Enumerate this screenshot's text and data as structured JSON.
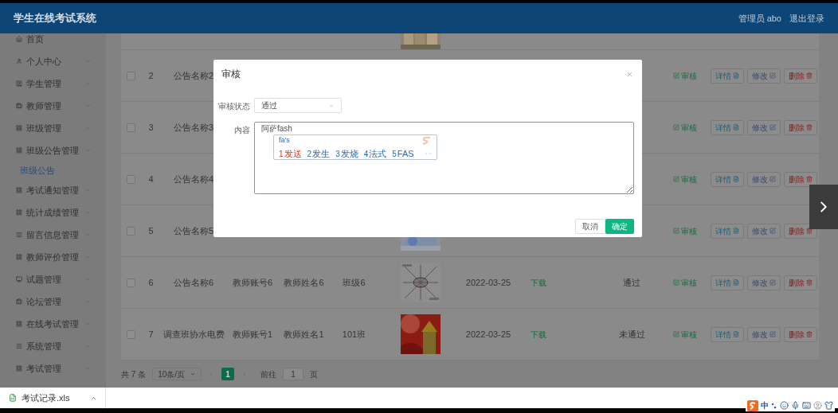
{
  "header": {
    "title": "学生在线考试系统",
    "user": "管理员 abo",
    "logout": "退出登录"
  },
  "sidebar": {
    "items": [
      {
        "label": "首页"
      },
      {
        "label": "个人中心"
      },
      {
        "label": "学生管理"
      },
      {
        "label": "教师管理"
      },
      {
        "label": "班级管理"
      },
      {
        "label": "班级公告管理",
        "children": [
          {
            "label": "班级公告",
            "selected": true
          }
        ]
      },
      {
        "label": "考试通知管理"
      },
      {
        "label": "统计成绩管理"
      },
      {
        "label": "留言信息管理"
      },
      {
        "label": "教师评价管理"
      },
      {
        "label": "试题管理"
      },
      {
        "label": "论坛管理"
      },
      {
        "label": "在线考试管理"
      },
      {
        "label": "系统管理"
      },
      {
        "label": "考试管理"
      }
    ]
  },
  "table": {
    "rows": [
      {
        "partial": true
      },
      {
        "checked": false,
        "index": "2",
        "name": "公告名称2",
        "review": "审核",
        "actions": [
          {
            "label": "详情",
            "kind": "detail"
          },
          {
            "label": "修改",
            "kind": "edit"
          },
          {
            "label": "删除",
            "kind": "delete"
          }
        ]
      },
      {
        "checked": false,
        "index": "3",
        "name": "公告名称3",
        "review": "审核",
        "actions": [
          {
            "label": "详情",
            "kind": "detail"
          },
          {
            "label": "修改",
            "kind": "edit"
          },
          {
            "label": "删除",
            "kind": "delete"
          }
        ]
      },
      {
        "checked": false,
        "index": "4",
        "name": "公告名称4",
        "review": "审核",
        "actions": [
          {
            "label": "详情",
            "kind": "detail"
          },
          {
            "label": "修改",
            "kind": "edit"
          },
          {
            "label": "删除",
            "kind": "delete"
          }
        ]
      },
      {
        "checked": false,
        "index": "5",
        "name": "公告名称5",
        "review": "审核",
        "actions": [
          {
            "label": "详情",
            "kind": "detail"
          },
          {
            "label": "修改",
            "kind": "edit"
          },
          {
            "label": "删除",
            "kind": "delete"
          }
        ]
      },
      {
        "checked": false,
        "index": "6",
        "name": "公告名称6",
        "account": "教师账号6",
        "teacher": "教师姓名6",
        "class": "班级6",
        "date": "2022-03-25",
        "download": "下载",
        "status": "通过",
        "review": "审核",
        "actions": [
          {
            "label": "详情",
            "kind": "detail"
          },
          {
            "label": "修改",
            "kind": "edit"
          },
          {
            "label": "删除",
            "kind": "delete"
          }
        ]
      },
      {
        "checked": false,
        "index": "7",
        "name": "调查班协水电费",
        "account": "教师账号1",
        "teacher": "教师姓名1",
        "class": "101班",
        "date": "2022-03-25",
        "download": "下载",
        "status": "未通过",
        "review": "审核",
        "actions": [
          {
            "label": "详情",
            "kind": "detail"
          },
          {
            "label": "修改",
            "kind": "edit"
          },
          {
            "label": "删除",
            "kind": "delete"
          }
        ]
      }
    ]
  },
  "pagination": {
    "total": "共 7 条",
    "page_size": "10条/页",
    "pages": [
      {
        "label": "1",
        "selected": true
      }
    ],
    "goto_label": "前往",
    "goto_value": "1",
    "goto_suffix": "页"
  },
  "dialog": {
    "title": "审核",
    "fields": [
      {
        "label": "审核状态",
        "kind": "select",
        "value": "通过"
      },
      {
        "label": "内容",
        "kind": "textarea",
        "value": "阿萨fash"
      }
    ],
    "ime": {
      "composition": "fa's",
      "candidates": [
        {
          "number": "1",
          "word": "发送",
          "selected": true
        },
        {
          "number": "2",
          "word": "发生",
          "selected": false
        },
        {
          "number": "3",
          "word": "发烧",
          "selected": false
        },
        {
          "number": "4",
          "word": "法式",
          "selected": false
        },
        {
          "number": "5",
          "word": "FAS",
          "selected": false
        }
      ]
    },
    "buttons": [
      {
        "label": "取消",
        "kind": "secondary"
      },
      {
        "label": "确定",
        "kind": "primary"
      }
    ]
  },
  "downloads": [
    {
      "file": "考试记录.xls"
    }
  ],
  "tray": {
    "ime_mode": "中"
  }
}
